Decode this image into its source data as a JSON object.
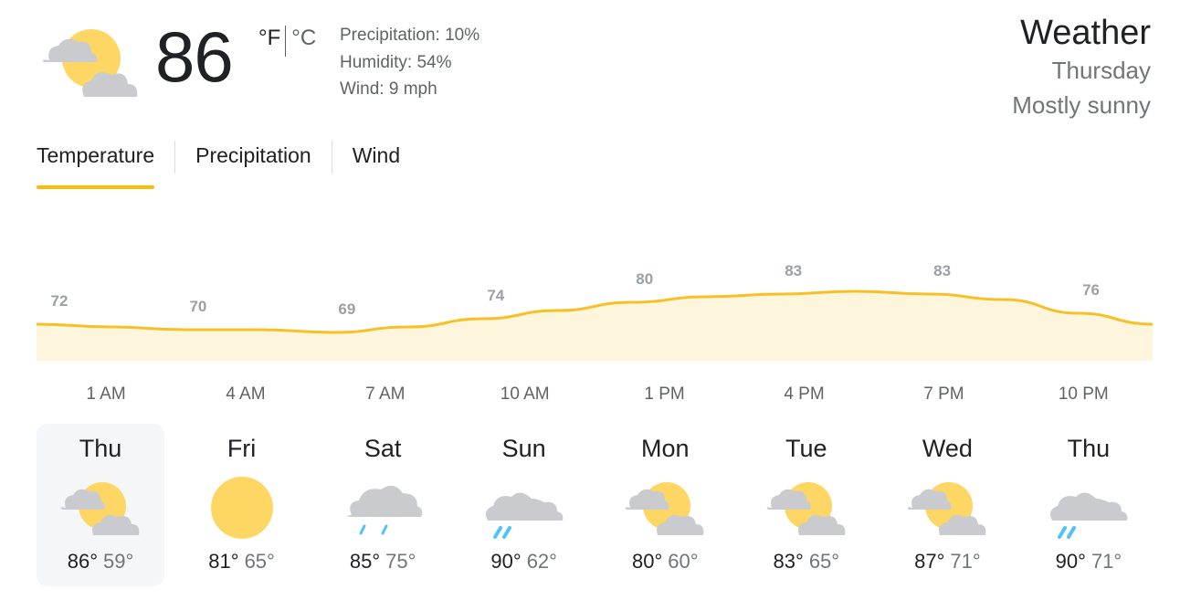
{
  "current": {
    "temp": "86",
    "unit_f": "°F",
    "unit_c": "°C",
    "precipitation": "Precipitation: 10%",
    "humidity": "Humidity: 54%",
    "wind": "Wind: 9 mph",
    "icon": "partly-cloudy-icon"
  },
  "header": {
    "title": "Weather",
    "day": "Thursday",
    "condition": "Mostly sunny"
  },
  "tabs": [
    {
      "label": "Temperature",
      "active": true
    },
    {
      "label": "Precipitation",
      "active": false
    },
    {
      "label": "Wind",
      "active": false
    }
  ],
  "colors": {
    "accent": "#fbbc04",
    "line": "#f6c026",
    "fill": "#fef6dc",
    "sun": "#fdd663",
    "cloud": "#c9cbce",
    "rain": "#4fc3f7"
  },
  "chart_data": {
    "type": "area",
    "x": [
      "1 AM",
      "",
      "4 AM",
      "",
      "7 AM",
      "",
      "10 AM",
      "",
      "1 PM",
      "",
      "4 PM",
      "",
      "7 PM",
      "",
      "10 PM",
      ""
    ],
    "x_tick_labels": [
      "1 AM",
      "4 AM",
      "7 AM",
      "10 AM",
      "1 PM",
      "4 PM",
      "7 PM",
      "10 PM"
    ],
    "values": [
      72,
      71,
      70,
      70,
      69,
      71,
      74,
      77,
      80,
      82,
      83,
      84,
      83,
      81,
      76,
      72
    ],
    "data_labels": [
      72,
      70,
      69,
      74,
      80,
      83,
      83,
      76
    ],
    "ylim": [
      60,
      90
    ]
  },
  "days": [
    {
      "name": "Thu",
      "hi": "86°",
      "lo": "59°",
      "icon": "partly-cloudy-icon",
      "selected": true
    },
    {
      "name": "Fri",
      "hi": "81°",
      "lo": "65°",
      "icon": "sunny-icon",
      "selected": false
    },
    {
      "name": "Sat",
      "hi": "85°",
      "lo": "75°",
      "icon": "showers-icon",
      "selected": false
    },
    {
      "name": "Sun",
      "hi": "90°",
      "lo": "62°",
      "icon": "scattered-showers-icon",
      "selected": false
    },
    {
      "name": "Mon",
      "hi": "80°",
      "lo": "60°",
      "icon": "partly-cloudy-icon",
      "selected": false
    },
    {
      "name": "Tue",
      "hi": "83°",
      "lo": "65°",
      "icon": "partly-cloudy-icon",
      "selected": false
    },
    {
      "name": "Wed",
      "hi": "87°",
      "lo": "71°",
      "icon": "partly-cloudy-icon",
      "selected": false
    },
    {
      "name": "Thu",
      "hi": "90°",
      "lo": "71°",
      "icon": "scattered-showers-icon",
      "selected": false
    }
  ]
}
